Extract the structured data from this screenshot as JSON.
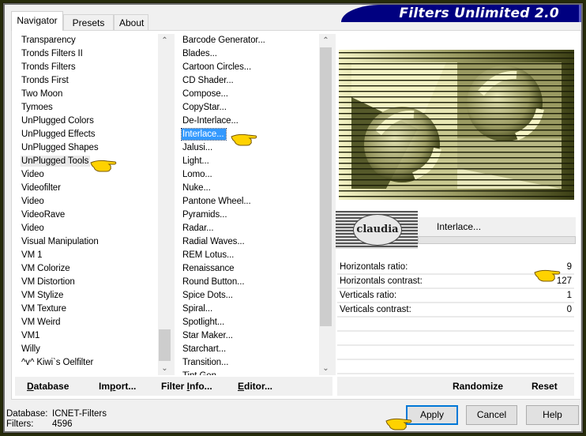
{
  "app_title": "Filters Unlimited 2.0",
  "tabs": [
    {
      "label": "Navigator",
      "active": true
    },
    {
      "label": "Presets",
      "active": false
    },
    {
      "label": "About",
      "active": false
    }
  ],
  "categories": {
    "items": [
      "Transparency",
      "Tronds Filters II",
      "Tronds Filters",
      "Tronds First",
      "Two Moon",
      "Tymoes",
      "UnPlugged Colors",
      "UnPlugged Effects",
      "UnPlugged Shapes",
      "UnPlugged Tools",
      "Video",
      "Videofilter",
      "Video",
      "VideoRave",
      "Video",
      "Visual Manipulation",
      "VM 1",
      "VM Colorize",
      "VM Distortion",
      "VM Stylize",
      "VM Texture",
      "VM Weird",
      "VM1",
      "Willy",
      "^v^ Kiwi`s Oelfilter"
    ],
    "highlighted": "UnPlugged Tools"
  },
  "filters": {
    "items": [
      "Barcode Generator...",
      "Blades...",
      "Cartoon Circles...",
      "CD Shader...",
      "Compose...",
      "CopyStar...",
      "De-Interlace...",
      "Interlace...",
      "Jalusi...",
      "Light...",
      "Lomo...",
      "Nuke...",
      "Pantone Wheel...",
      "Pyramids...",
      "Radar...",
      "Radial Waves...",
      "REM Lotus...",
      "Renaissance",
      "Round Button...",
      "Spice Dots...",
      "Spiral...",
      "Spotlight...",
      "Star Maker...",
      "Starchart...",
      "Transition...",
      "Tint Gen..."
    ],
    "selected": "Interlace..."
  },
  "preview": {
    "filter_name": "Interlace...",
    "logo_text": "claudia",
    "colors": {
      "dark": "#3b3f14",
      "mid": "#9a9a62",
      "light": "#f4f3c4"
    }
  },
  "parameters": [
    {
      "label": "Horizontals ratio:",
      "value": "9"
    },
    {
      "label": "Horizontals contrast:",
      "value": "127"
    },
    {
      "label": "Verticals ratio:",
      "value": "1"
    },
    {
      "label": "Verticals contrast:",
      "value": "0"
    }
  ],
  "left_buttons": {
    "database": {
      "pre": "",
      "u": "D",
      "post": "atabase"
    },
    "import": {
      "pre": "Im",
      "u": "p",
      "post": "ort..."
    },
    "filter_info": {
      "pre": "Filter ",
      "u": "I",
      "post": "nfo..."
    },
    "editor": {
      "pre": "",
      "u": "E",
      "post": "ditor..."
    }
  },
  "right_buttons": {
    "randomize": "Randomize",
    "reset": "Reset"
  },
  "status": {
    "database_label": "Database:",
    "database_value": "ICNET-Filters",
    "filters_label": "Filters:",
    "filters_value": "4596"
  },
  "dialog_buttons": {
    "apply": "Apply",
    "cancel": "Cancel",
    "help": "Help"
  },
  "scroll_icons": {
    "up": "^",
    "down": "v"
  }
}
